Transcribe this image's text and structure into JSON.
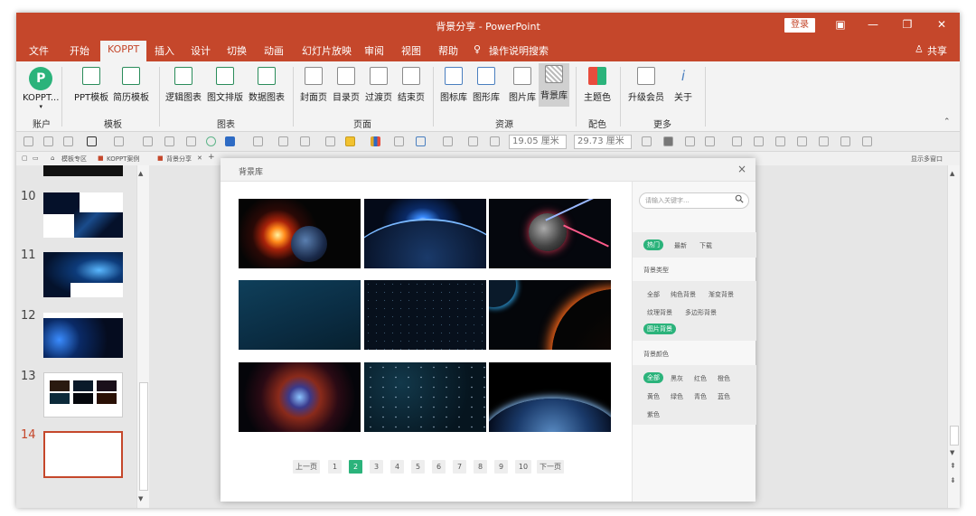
{
  "titlebar": {
    "title": "背景分享 - PowerPoint",
    "login": "登录"
  },
  "menu": {
    "items": [
      "文件",
      "开始",
      "KOPPT",
      "插入",
      "设计",
      "切换",
      "动画",
      "幻灯片放映",
      "审阅",
      "视图",
      "帮助",
      "操作说明搜索"
    ],
    "share": "共享"
  },
  "ribbon": {
    "account": {
      "label": "KOPPT...",
      "group": "账户"
    },
    "template": {
      "items": [
        "PPT模板",
        "简历模板"
      ],
      "group": "模板"
    },
    "chart": {
      "items": [
        "逻辑图表",
        "图文排版",
        "数据图表"
      ],
      "group": "图表"
    },
    "page": {
      "items": [
        "封面页",
        "目录页",
        "过渡页",
        "结束页"
      ],
      "group": "页面"
    },
    "resource": {
      "items": [
        "图标库",
        "图形库",
        "图片库",
        "背景库"
      ],
      "group": "资源"
    },
    "color": {
      "items": [
        "主题色"
      ],
      "group": "配色"
    },
    "more": {
      "items": [
        "升级会员",
        "关于"
      ],
      "group": "更多"
    }
  },
  "toolbar": {
    "width": "19.05 厘米",
    "height": "29.73 厘米"
  },
  "tabs": {
    "items": [
      "模板专区",
      "KOPPT案例",
      "背景分享"
    ],
    "right": "显示多窗口"
  },
  "slides": {
    "numbers": [
      "10",
      "11",
      "12",
      "13",
      "14"
    ]
  },
  "dialog": {
    "title": "背景库",
    "close": "×",
    "pager": [
      "上一页",
      "1",
      "2",
      "3",
      "4",
      "5",
      "6",
      "7",
      "8",
      "9",
      "10",
      "下一页"
    ],
    "search_placeholder": "请输入关键字...",
    "filter_tabs": [
      "热门",
      "最新",
      "下载"
    ],
    "type_title": "背景类型",
    "types": [
      "全部",
      "纯色背景",
      "渐变背景",
      "纹理背景",
      "多边形背景",
      "图片背景"
    ],
    "color_title": "背景颜色",
    "colors": [
      "全部",
      "黑灰",
      "红色",
      "橙色",
      "黄色",
      "绿色",
      "青色",
      "蓝色",
      "紫色"
    ]
  }
}
